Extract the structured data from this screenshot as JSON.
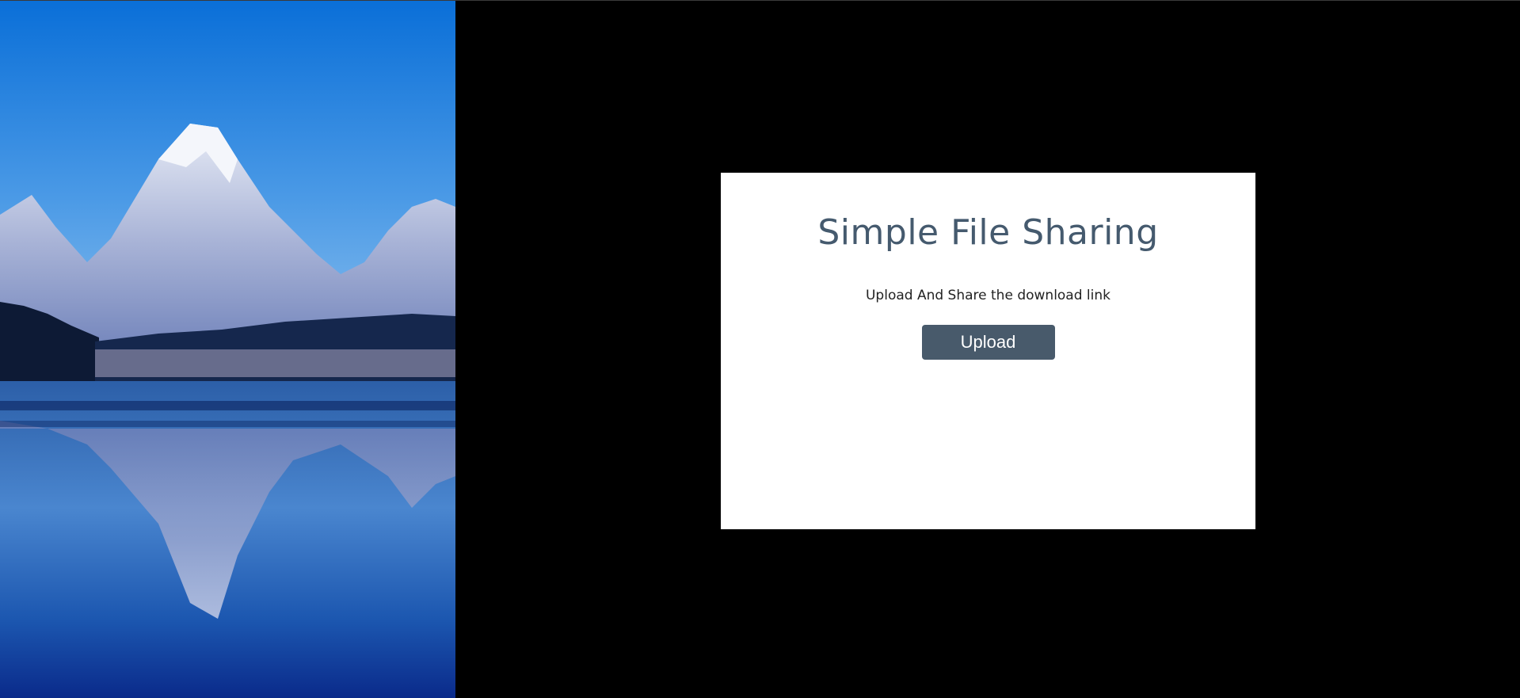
{
  "card": {
    "title": "Simple File Sharing",
    "subtitle": "Upload And Share the download link",
    "upload_label": "Upload"
  },
  "colors": {
    "page_background": "#000000",
    "card_background": "#ffffff",
    "title_color": "#455a6e",
    "button_background": "#485a6b",
    "button_text": "#ffffff"
  }
}
